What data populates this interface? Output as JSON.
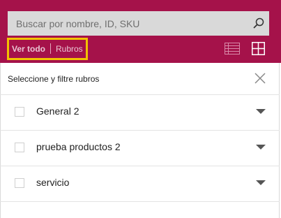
{
  "colors": {
    "header_bg": "#a5124a",
    "search_bg": "#d9d9d9",
    "highlight": "#f2c200"
  },
  "search": {
    "placeholder": "Buscar por nombre, ID, SKU"
  },
  "tabs": {
    "all_label": "Ver todo",
    "rubros_label": "Rubros"
  },
  "view_toggle": {
    "list_icon": "list-view-icon",
    "grid_icon": "grid-view-icon"
  },
  "filter": {
    "title": "Seleccione y filtre rubros",
    "close_icon": "close-icon"
  },
  "categories": [
    {
      "label": "General 2"
    },
    {
      "label": "prueba productos 2"
    },
    {
      "label": "servicio"
    }
  ]
}
